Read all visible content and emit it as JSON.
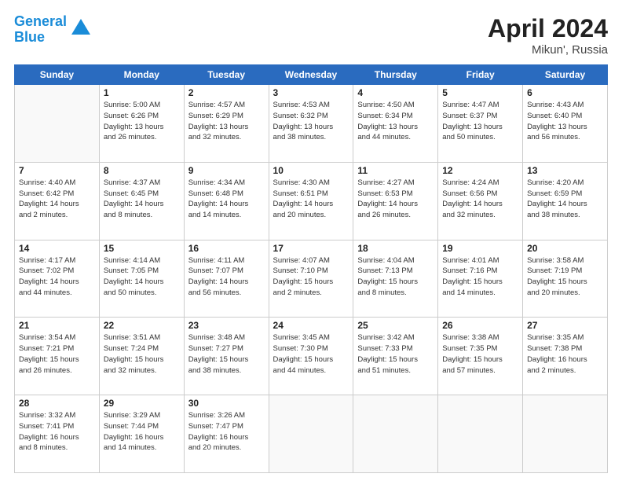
{
  "header": {
    "logo_line1": "General",
    "logo_line2": "Blue",
    "month": "April 2024",
    "location": "Mikun', Russia"
  },
  "weekdays": [
    "Sunday",
    "Monday",
    "Tuesday",
    "Wednesday",
    "Thursday",
    "Friday",
    "Saturday"
  ],
  "weeks": [
    [
      {
        "day": "",
        "info": ""
      },
      {
        "day": "1",
        "info": "Sunrise: 5:00 AM\nSunset: 6:26 PM\nDaylight: 13 hours\nand 26 minutes."
      },
      {
        "day": "2",
        "info": "Sunrise: 4:57 AM\nSunset: 6:29 PM\nDaylight: 13 hours\nand 32 minutes."
      },
      {
        "day": "3",
        "info": "Sunrise: 4:53 AM\nSunset: 6:32 PM\nDaylight: 13 hours\nand 38 minutes."
      },
      {
        "day": "4",
        "info": "Sunrise: 4:50 AM\nSunset: 6:34 PM\nDaylight: 13 hours\nand 44 minutes."
      },
      {
        "day": "5",
        "info": "Sunrise: 4:47 AM\nSunset: 6:37 PM\nDaylight: 13 hours\nand 50 minutes."
      },
      {
        "day": "6",
        "info": "Sunrise: 4:43 AM\nSunset: 6:40 PM\nDaylight: 13 hours\nand 56 minutes."
      }
    ],
    [
      {
        "day": "7",
        "info": "Sunrise: 4:40 AM\nSunset: 6:42 PM\nDaylight: 14 hours\nand 2 minutes."
      },
      {
        "day": "8",
        "info": "Sunrise: 4:37 AM\nSunset: 6:45 PM\nDaylight: 14 hours\nand 8 minutes."
      },
      {
        "day": "9",
        "info": "Sunrise: 4:34 AM\nSunset: 6:48 PM\nDaylight: 14 hours\nand 14 minutes."
      },
      {
        "day": "10",
        "info": "Sunrise: 4:30 AM\nSunset: 6:51 PM\nDaylight: 14 hours\nand 20 minutes."
      },
      {
        "day": "11",
        "info": "Sunrise: 4:27 AM\nSunset: 6:53 PM\nDaylight: 14 hours\nand 26 minutes."
      },
      {
        "day": "12",
        "info": "Sunrise: 4:24 AM\nSunset: 6:56 PM\nDaylight: 14 hours\nand 32 minutes."
      },
      {
        "day": "13",
        "info": "Sunrise: 4:20 AM\nSunset: 6:59 PM\nDaylight: 14 hours\nand 38 minutes."
      }
    ],
    [
      {
        "day": "14",
        "info": "Sunrise: 4:17 AM\nSunset: 7:02 PM\nDaylight: 14 hours\nand 44 minutes."
      },
      {
        "day": "15",
        "info": "Sunrise: 4:14 AM\nSunset: 7:05 PM\nDaylight: 14 hours\nand 50 minutes."
      },
      {
        "day": "16",
        "info": "Sunrise: 4:11 AM\nSunset: 7:07 PM\nDaylight: 14 hours\nand 56 minutes."
      },
      {
        "day": "17",
        "info": "Sunrise: 4:07 AM\nSunset: 7:10 PM\nDaylight: 15 hours\nand 2 minutes."
      },
      {
        "day": "18",
        "info": "Sunrise: 4:04 AM\nSunset: 7:13 PM\nDaylight: 15 hours\nand 8 minutes."
      },
      {
        "day": "19",
        "info": "Sunrise: 4:01 AM\nSunset: 7:16 PM\nDaylight: 15 hours\nand 14 minutes."
      },
      {
        "day": "20",
        "info": "Sunrise: 3:58 AM\nSunset: 7:19 PM\nDaylight: 15 hours\nand 20 minutes."
      }
    ],
    [
      {
        "day": "21",
        "info": "Sunrise: 3:54 AM\nSunset: 7:21 PM\nDaylight: 15 hours\nand 26 minutes."
      },
      {
        "day": "22",
        "info": "Sunrise: 3:51 AM\nSunset: 7:24 PM\nDaylight: 15 hours\nand 32 minutes."
      },
      {
        "day": "23",
        "info": "Sunrise: 3:48 AM\nSunset: 7:27 PM\nDaylight: 15 hours\nand 38 minutes."
      },
      {
        "day": "24",
        "info": "Sunrise: 3:45 AM\nSunset: 7:30 PM\nDaylight: 15 hours\nand 44 minutes."
      },
      {
        "day": "25",
        "info": "Sunrise: 3:42 AM\nSunset: 7:33 PM\nDaylight: 15 hours\nand 51 minutes."
      },
      {
        "day": "26",
        "info": "Sunrise: 3:38 AM\nSunset: 7:35 PM\nDaylight: 15 hours\nand 57 minutes."
      },
      {
        "day": "27",
        "info": "Sunrise: 3:35 AM\nSunset: 7:38 PM\nDaylight: 16 hours\nand 2 minutes."
      }
    ],
    [
      {
        "day": "28",
        "info": "Sunrise: 3:32 AM\nSunset: 7:41 PM\nDaylight: 16 hours\nand 8 minutes."
      },
      {
        "day": "29",
        "info": "Sunrise: 3:29 AM\nSunset: 7:44 PM\nDaylight: 16 hours\nand 14 minutes."
      },
      {
        "day": "30",
        "info": "Sunrise: 3:26 AM\nSunset: 7:47 PM\nDaylight: 16 hours\nand 20 minutes."
      },
      {
        "day": "",
        "info": ""
      },
      {
        "day": "",
        "info": ""
      },
      {
        "day": "",
        "info": ""
      },
      {
        "day": "",
        "info": ""
      }
    ]
  ]
}
